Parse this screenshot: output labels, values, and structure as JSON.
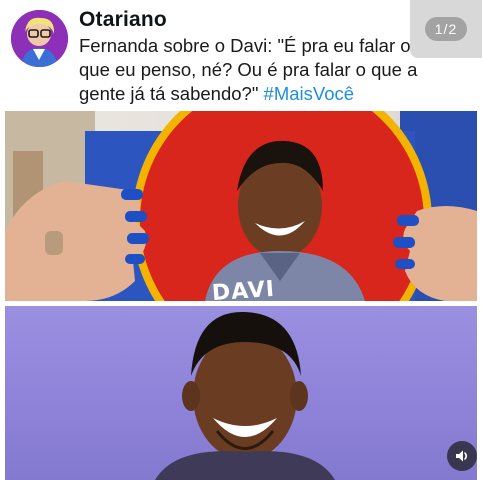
{
  "post": {
    "author": "Otariano",
    "text_main": "Fernanda sobre o Davi: \"É pra eu falar o que eu penso, né? Ou é pra falar o que a gente já tá sabendo?\" ",
    "hashtag": "#MaisVocê",
    "page_indicator": "1/2"
  },
  "media": {
    "image1_shirt_text": "DAVI",
    "colors": {
      "hashtag": "#1d8fe0",
      "card_red": "#d9261c",
      "card_border": "#f2b400",
      "nails": "#1f4fc4",
      "backdrop_purple": "#8d82d8"
    }
  },
  "icons": {
    "sound": "speaker-icon"
  }
}
